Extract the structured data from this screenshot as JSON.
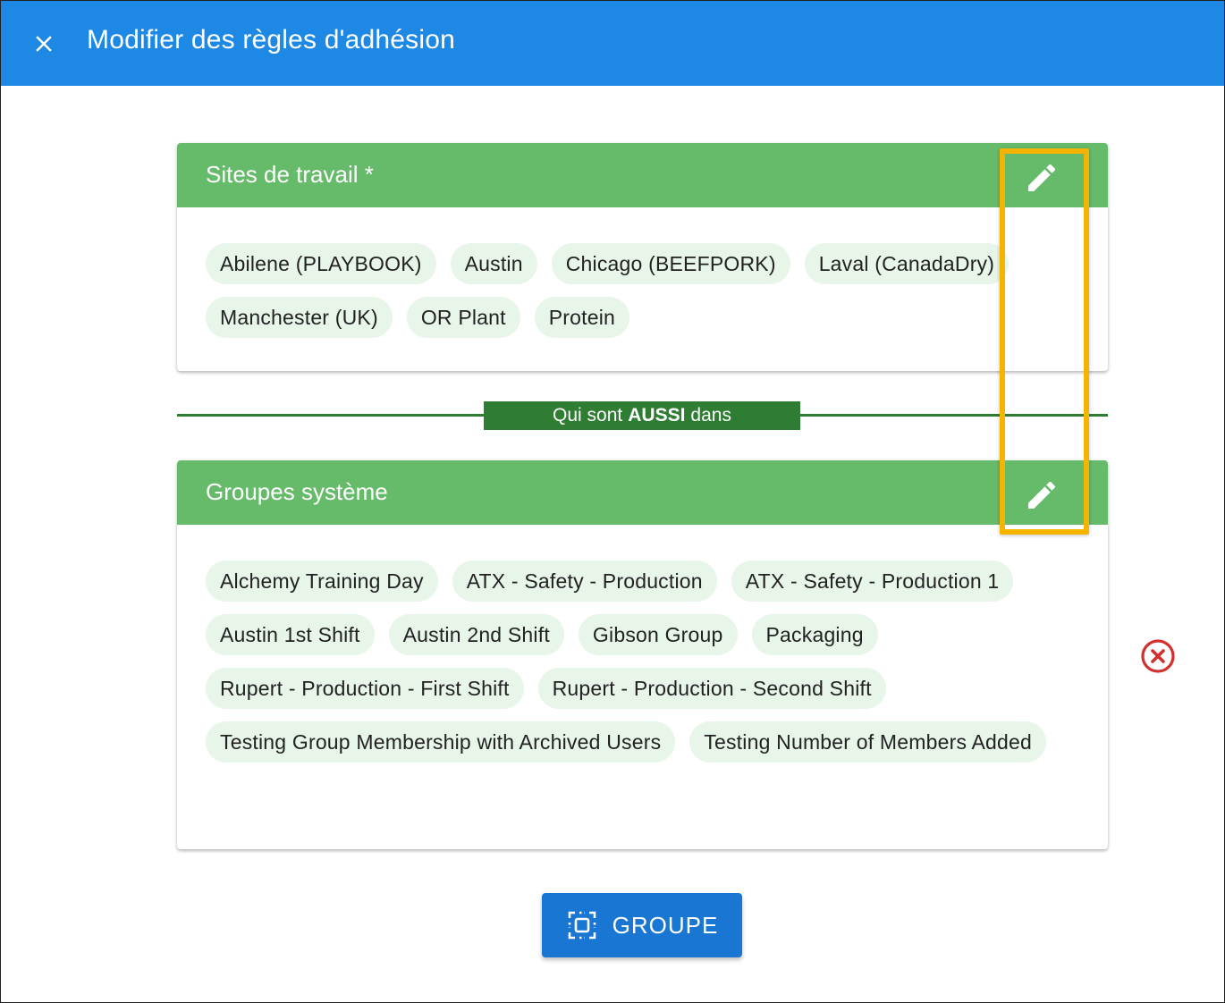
{
  "dialog": {
    "title": "Modifier des règles d'adhésion",
    "close_icon": "close-icon"
  },
  "colors": {
    "topbar": "#1e88e5",
    "card_header": "#66bb6a",
    "chip_bg": "#e8f5e9",
    "divider": "#2e7d32",
    "highlight": "#f5b400",
    "remove": "#d32f2f",
    "primary_button": "#1976d2"
  },
  "rules": [
    {
      "title": "Sites de travail *",
      "edit_icon": "pencil-icon",
      "chips": [
        "Abilene (PLAYBOOK)",
        "Austin",
        "Chicago (BEEFPORK)",
        "Laval (CanadaDry)",
        "Manchester (UK)",
        "OR Plant",
        "Protein"
      ]
    },
    {
      "title": "Groupes système",
      "edit_icon": "pencil-icon",
      "chips": [
        "Alchemy Training Day",
        "ATX - Safety - Production",
        "ATX - Safety - Production 1",
        "Austin 1st Shift",
        "Austin 2nd Shift",
        "Gibson Group",
        "Packaging",
        "Rupert - Production - First Shift",
        "Rupert - Production - Second Shift",
        "Testing Group Membership with Archived Users",
        "Testing Number of Members Added"
      ]
    }
  ],
  "connector": {
    "prefix": "Qui sont",
    "emphasis": "AUSSI",
    "suffix": "dans"
  },
  "remove_icon": "remove-circle-icon",
  "add_button": {
    "label": "GROUPE",
    "icon": "group-select-icon"
  }
}
